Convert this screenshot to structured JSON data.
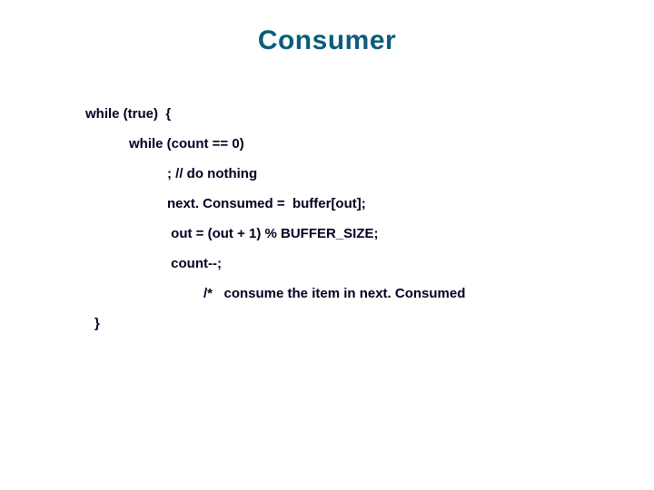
{
  "title": "Consumer",
  "code": {
    "l1": "while (true)  {",
    "l2": "while (count == 0)",
    "l3": "; // do nothing",
    "l4": "next. Consumed =  buffer[out];",
    "l5": " out = (out + 1) % BUFFER_SIZE;",
    "l6": " count--;",
    "l7": "/*   consume the item in next. Consumed",
    "l8": "}"
  }
}
